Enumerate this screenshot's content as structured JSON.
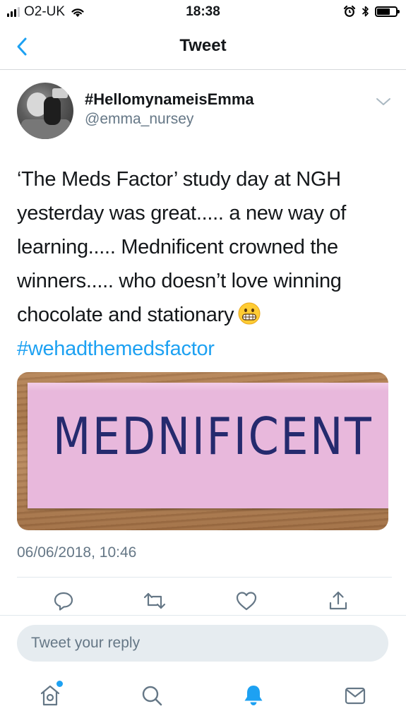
{
  "status_bar": {
    "carrier": "O2-UK",
    "time": "18:38",
    "signal_bars": 4,
    "signal_bars_filled": 3,
    "battery_level": 0.7,
    "icons": [
      "signal-icon",
      "wifi-icon",
      "alarm-icon",
      "bluetooth-icon",
      "battery-icon"
    ]
  },
  "nav": {
    "title": "Tweet",
    "back_icon": "chevron-left-icon"
  },
  "tweet": {
    "display_name": "#HellomynameisEmma",
    "handle": "@emma_nursey",
    "text_lines": [
      "‘The Meds Factor’ study day at NGH",
      "yesterday was great..... a new way of",
      "learning..... Mednificent crowned the",
      "winners..... who doesn’t love winning",
      "chocolate and stationary"
    ],
    "emoji": "grimacing-face-emoji",
    "hashtag": "#wehadthemedsfactor",
    "media_text": "MEDNIFICENT",
    "timestamp": "06/06/2018, 10:46"
  },
  "actions": [
    "reply-icon",
    "retweet-icon",
    "like-icon",
    "share-icon"
  ],
  "reply": {
    "placeholder": "Tweet your reply"
  },
  "tab_bar": {
    "tabs": [
      "home-icon",
      "search-icon",
      "notifications-icon",
      "messages-icon"
    ],
    "active": "notifications-icon",
    "home_has_new": true
  },
  "colors": {
    "accent": "#1da1f2",
    "text": "#14171a",
    "secondary": "#657786",
    "media_card": "#e8b8dc",
    "media_ink": "#252a6e"
  }
}
